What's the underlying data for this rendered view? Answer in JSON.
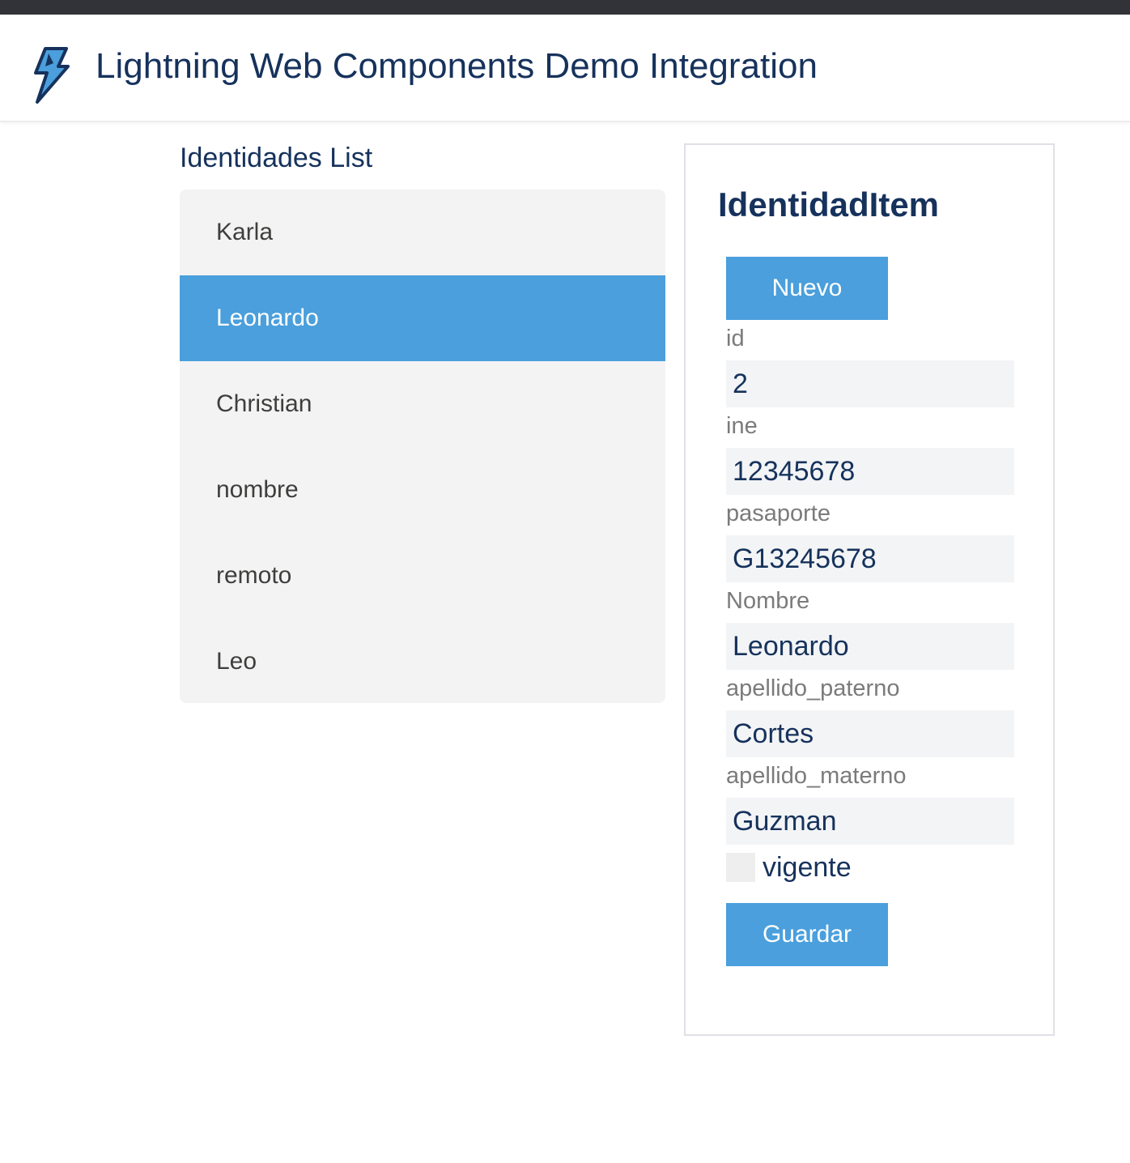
{
  "colors": {
    "top_strip": "#323338",
    "brand_text": "#16325c",
    "accent": "#4a9fdc",
    "list_bg": "#f4f3f4",
    "input_bg": "#f3f4f6",
    "label": "#7b7b7b"
  },
  "header": {
    "logo_icon": "lightning-bolt-icon",
    "title": "Lightning Web Components Demo Integration"
  },
  "list": {
    "title": "Identidades List",
    "selected_index": 1,
    "items": [
      {
        "label": "Karla"
      },
      {
        "label": "Leonardo"
      },
      {
        "label": "Christian"
      },
      {
        "label": "nombre"
      },
      {
        "label": "remoto"
      },
      {
        "label": "Leo"
      }
    ]
  },
  "item": {
    "title": "IdentidadItem",
    "new_button": "Nuevo",
    "fields": [
      {
        "label": "id",
        "value": "2"
      },
      {
        "label": "ine",
        "value": "12345678"
      },
      {
        "label": "pasaporte",
        "value": "G13245678"
      },
      {
        "label": "Nombre",
        "value": "Leonardo"
      },
      {
        "label": "apellido_paterno",
        "value": "Cortes"
      },
      {
        "label": "apellido_materno",
        "value": "Guzman"
      }
    ],
    "vigente": {
      "label": "vigente",
      "checked": false
    },
    "save_button": "Guardar"
  }
}
